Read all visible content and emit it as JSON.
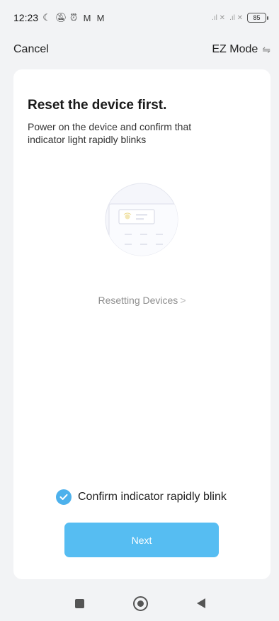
{
  "status_bar": {
    "time": "12:23",
    "icons": [
      "moon-icon",
      "bell-off-icon",
      "alarm-icon",
      "gmail-icon",
      "gmail-icon"
    ],
    "signal": ".ıl",
    "battery": "85"
  },
  "nav": {
    "cancel_label": "Cancel",
    "mode_label": "EZ Mode"
  },
  "card": {
    "title": "Reset the device first.",
    "subtitle": "Power on the device and confirm that indicator light rapidly blinks",
    "reset_link_label": "Resetting Devices",
    "confirm_label": "Confirm indicator rapidly blink",
    "confirm_checked": true,
    "next_label": "Next"
  },
  "colors": {
    "accent": "#56bdf2",
    "check": "#4db1ec",
    "background": "#f2f3f5"
  }
}
